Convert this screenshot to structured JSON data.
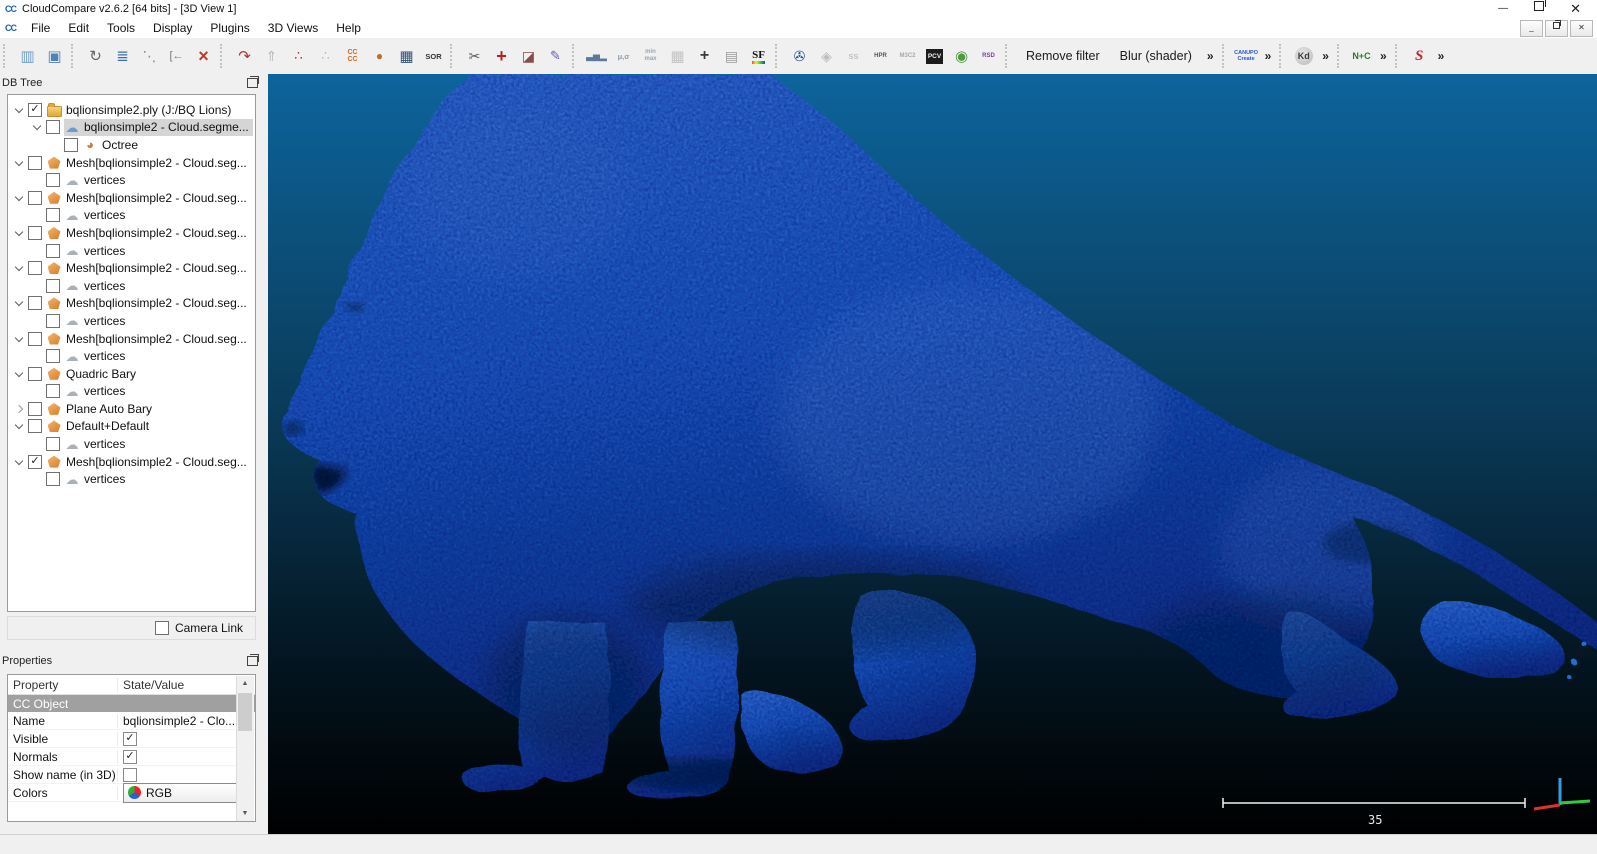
{
  "window": {
    "title": "CloudCompare v2.6.2 [64 bits] - [3D View 1]",
    "logo_text": "CC"
  },
  "menu": {
    "items": [
      "File",
      "Edit",
      "Tools",
      "Display",
      "Plugins",
      "3D Views",
      "Help"
    ]
  },
  "toolbar": {
    "groups": [
      {
        "items": [
          {
            "id": "open-icon",
            "glyph": "▥",
            "fg": "#6f9cc9",
            "size": 15
          },
          {
            "id": "save-icon",
            "glyph": "▣",
            "fg": "#4f81bd",
            "size": 15
          }
        ]
      },
      {
        "items": [
          {
            "id": "pick-rotation-center-icon",
            "glyph": "↻",
            "fg": "#666666",
            "size": 15
          },
          {
            "id": "properties-list-icon",
            "glyph": "≣",
            "fg": "#3b6fb5",
            "size": 15
          },
          {
            "id": "point-list-picking-icon",
            "glyph": "⋱",
            "fg": "#888888",
            "size": 14
          },
          {
            "id": "apply-transformation-icon",
            "glyph": "[←",
            "fg": "#777777",
            "size": 11
          },
          {
            "id": "delete-icon",
            "glyph": "×",
            "fg": "#c23a2f",
            "size": 18,
            "bold": true
          }
        ]
      },
      {
        "items": [
          {
            "id": "clone-icon",
            "glyph": "↷",
            "fg": "#b8312f",
            "size": 15
          },
          {
            "id": "merge-icon",
            "glyph": "⇑",
            "fg": "#b9b9b9",
            "size": 14
          },
          {
            "id": "subsample-icon",
            "glyph": "∴",
            "fg": "#b03030",
            "size": 13
          },
          {
            "id": "resample-icon",
            "glyph": "∴",
            "fg": "#b9b9b9",
            "size": 13
          },
          {
            "id": "cloud-cloud-distance-icon",
            "glyph": "CC\nCC",
            "cls": "glyph-cc",
            "fg": "#d2691e"
          },
          {
            "id": "cloud-mesh-distance-icon",
            "glyph": "●",
            "fg": "#b5712f",
            "size": 12
          },
          {
            "id": "statistical-test-icon",
            "glyph": "▦",
            "fg": "#2e4f7a",
            "size": 15
          },
          {
            "id": "sor-filter-icon",
            "glyph": "SOR",
            "cls": "small-label",
            "fg": "#333333"
          }
        ]
      },
      {
        "items": [
          {
            "id": "crop-icon",
            "glyph": "✂",
            "fg": "#555555",
            "size": 14
          },
          {
            "id": "translate-rotate-icon",
            "glyph": "+",
            "fg": "#b22222",
            "size": 18,
            "bold": true
          },
          {
            "id": "clipping-box-icon",
            "glyph": "◪",
            "fg": "#8a4a4a",
            "size": 14
          },
          {
            "id": "segment-icon",
            "glyph": "✎",
            "fg": "#6a4fc0",
            "size": 13
          }
        ]
      },
      {
        "items": [
          {
            "id": "histogram-icon",
            "glyph": "▃▅▂",
            "fg": "#5b7a9a",
            "size": 9
          },
          {
            "id": "gauss-filter-icon",
            "glyph": "μ,σ",
            "cls": "small-label",
            "fg": "#8a9bb0"
          },
          {
            "id": "minmax-filter-icon",
            "glyph": "min\nmax",
            "cls": "tiny-label",
            "fg": "#9aa5ad"
          },
          {
            "id": "delete-sf-icon",
            "glyph": "▦",
            "fg": "#c3c3c3",
            "size": 15
          },
          {
            "id": "add-sf-icon",
            "glyph": "+",
            "fg": "#3a3a3a",
            "size": 16,
            "bold": true
          },
          {
            "id": "sf-arithmetic-icon",
            "glyph": "▤",
            "fg": "#9a9a9a",
            "size": 14
          },
          {
            "id": "sf-color-scale-icon",
            "glyph": "SF",
            "cls": "glyph-sf",
            "fg": "#111111"
          }
        ]
      },
      {
        "items": [
          {
            "id": "animation-icon",
            "glyph": "✇",
            "fg": "#2f4f8f",
            "size": 14
          },
          {
            "id": "shield-plugin-icon",
            "glyph": "◈",
            "fg": "#bdbdbd",
            "size": 14
          },
          {
            "id": "ss-plugin-icon",
            "glyph": "SS",
            "cls": "small-label",
            "fg": "#c0c0c0"
          },
          {
            "id": "hpr-plugin-icon",
            "glyph": "HPR",
            "cls": "tiny-label",
            "fg": "#555555"
          },
          {
            "id": "m3c2-plugin-icon",
            "glyph": "M3C2",
            "cls": "tiny-label",
            "fg": "#a8a8a8"
          },
          {
            "id": "pcv-plugin-icon",
            "glyph": "PCV",
            "cls": "glyph-pcv",
            "fg": "#eeeeee"
          },
          {
            "id": "facets-plugin-icon",
            "glyph": "◉",
            "fg": "#4e9a3e",
            "size": 15
          },
          {
            "id": "rsd-plugin-icon",
            "glyph": "RSD",
            "cls": "tiny-label",
            "fg": "#7b3fa0"
          }
        ]
      },
      {
        "items": [
          {
            "id": "remove-filter-button",
            "kind": "button",
            "label": "Remove filter"
          },
          {
            "id": "blur-shader-button",
            "kind": "button",
            "label": "Blur (shader)"
          },
          {
            "id": "shader-more-chevron",
            "kind": "chev",
            "glyph": "»"
          }
        ]
      },
      {
        "items": [
          {
            "id": "canupo-create-icon",
            "glyph": "CANUPO\nCreate",
            "cls": "glyph-canupo"
          },
          {
            "id": "canupo-chevron",
            "kind": "chev",
            "glyph": "»"
          }
        ]
      },
      {
        "items": [
          {
            "id": "kd-tree-icon",
            "glyph": "Kd",
            "cls": "glyph-kd"
          },
          {
            "id": "kd-chevron",
            "kind": "chev",
            "glyph": "»"
          }
        ]
      },
      {
        "items": [
          {
            "id": "normals-plus-color-icon",
            "glyph": "N+C",
            "cls": "glyph-npc"
          },
          {
            "id": "npc-chevron",
            "kind": "chev",
            "glyph": "»"
          }
        ]
      },
      {
        "items": [
          {
            "id": "s-curve-plugin-icon",
            "glyph": "S",
            "cls": "glyph-scurve"
          },
          {
            "id": "scurve-chevron",
            "kind": "chev",
            "glyph": "»"
          }
        ]
      }
    ]
  },
  "db_tree": {
    "title": "DB Tree",
    "icon_glyphs": {
      "cloud-blue": "☁",
      "cloud-gray": "☁",
      "octree": "◕"
    },
    "camera_link_label": "Camera Link",
    "items": [
      {
        "exp": "open",
        "checked": true,
        "icon": "folder",
        "label": "bqlionsimple2.ply (J:/BQ Lions)",
        "indent": 0
      },
      {
        "exp": "open",
        "checked": false,
        "icon": "cloud-blue",
        "label": "bqlionsimple2 - Cloud.segme...",
        "indent": 1,
        "selected": true
      },
      {
        "exp": "none",
        "checked": false,
        "icon": "octree",
        "label": "Octree",
        "indent": 2
      },
      {
        "exp": "open",
        "checked": false,
        "icon": "mesh",
        "label": "Mesh[bqlionsimple2 - Cloud.seg...",
        "indent": 0
      },
      {
        "exp": "none",
        "checked": false,
        "icon": "cloud-gray",
        "label": "vertices",
        "indent": 1
      },
      {
        "exp": "open",
        "checked": false,
        "icon": "mesh",
        "label": "Mesh[bqlionsimple2 - Cloud.seg...",
        "indent": 0
      },
      {
        "exp": "none",
        "checked": false,
        "icon": "cloud-gray",
        "label": "vertices",
        "indent": 1
      },
      {
        "exp": "open",
        "checked": false,
        "icon": "mesh",
        "label": "Mesh[bqlionsimple2 - Cloud.seg...",
        "indent": 0
      },
      {
        "exp": "none",
        "checked": false,
        "icon": "cloud-gray",
        "label": "vertices",
        "indent": 1
      },
      {
        "exp": "open",
        "checked": false,
        "icon": "mesh",
        "label": "Mesh[bqlionsimple2 - Cloud.seg...",
        "indent": 0
      },
      {
        "exp": "none",
        "checked": false,
        "icon": "cloud-gray",
        "label": "vertices",
        "indent": 1
      },
      {
        "exp": "open",
        "checked": false,
        "icon": "mesh",
        "label": "Mesh[bqlionsimple2 - Cloud.seg...",
        "indent": 0
      },
      {
        "exp": "none",
        "checked": false,
        "icon": "cloud-gray",
        "label": "vertices",
        "indent": 1
      },
      {
        "exp": "open",
        "checked": false,
        "icon": "mesh",
        "label": "Mesh[bqlionsimple2 - Cloud.seg...",
        "indent": 0
      },
      {
        "exp": "none",
        "checked": false,
        "icon": "cloud-gray",
        "label": "vertices",
        "indent": 1
      },
      {
        "exp": "open",
        "checked": false,
        "icon": "mesh",
        "label": "Quadric Bary",
        "indent": 0
      },
      {
        "exp": "none",
        "checked": false,
        "icon": "cloud-gray",
        "label": "vertices",
        "indent": 1
      },
      {
        "exp": "closed",
        "checked": false,
        "icon": "mesh",
        "label": "Plane Auto Bary",
        "indent": 0
      },
      {
        "exp": "open",
        "checked": false,
        "icon": "mesh",
        "label": "Default+Default",
        "indent": 0
      },
      {
        "exp": "none",
        "checked": false,
        "icon": "cloud-gray",
        "label": "vertices",
        "indent": 1
      },
      {
        "exp": "open",
        "checked": true,
        "icon": "mesh",
        "label": "Mesh[bqlionsimple2 - Cloud.seg...",
        "indent": 0
      },
      {
        "exp": "none",
        "checked": false,
        "icon": "cloud-gray",
        "label": "vertices",
        "indent": 1
      }
    ]
  },
  "properties": {
    "title": "Properties",
    "columns": [
      "Property",
      "State/Value"
    ],
    "rows": [
      {
        "kind": "section",
        "label": "CC Object"
      },
      {
        "kind": "text",
        "label": "Name",
        "value": "bqlionsimple2 - Clo..."
      },
      {
        "kind": "check",
        "label": "Visible",
        "checked": true
      },
      {
        "kind": "check",
        "label": "Normals",
        "checked": true
      },
      {
        "kind": "check",
        "label": "Show name (in 3D)",
        "checked": false
      },
      {
        "kind": "dropdown",
        "label": "Colors",
        "value": "RGB"
      }
    ]
  },
  "viewport": {
    "scale_label": "35",
    "colors": {
      "bg_top": "#0d649c",
      "bg_mid": "#0a3a58",
      "bg_low": "#03141f",
      "bg_bottom": "#000000",
      "lion_light": "#3b87e6",
      "lion_base": "#1f6fd2",
      "lion_dark": "#0c3c86",
      "axis_x": "#e03030",
      "axis_y": "#2ecc40",
      "axis_z": "#2f9fe0",
      "scale_bar": "#f2f2f2"
    }
  }
}
